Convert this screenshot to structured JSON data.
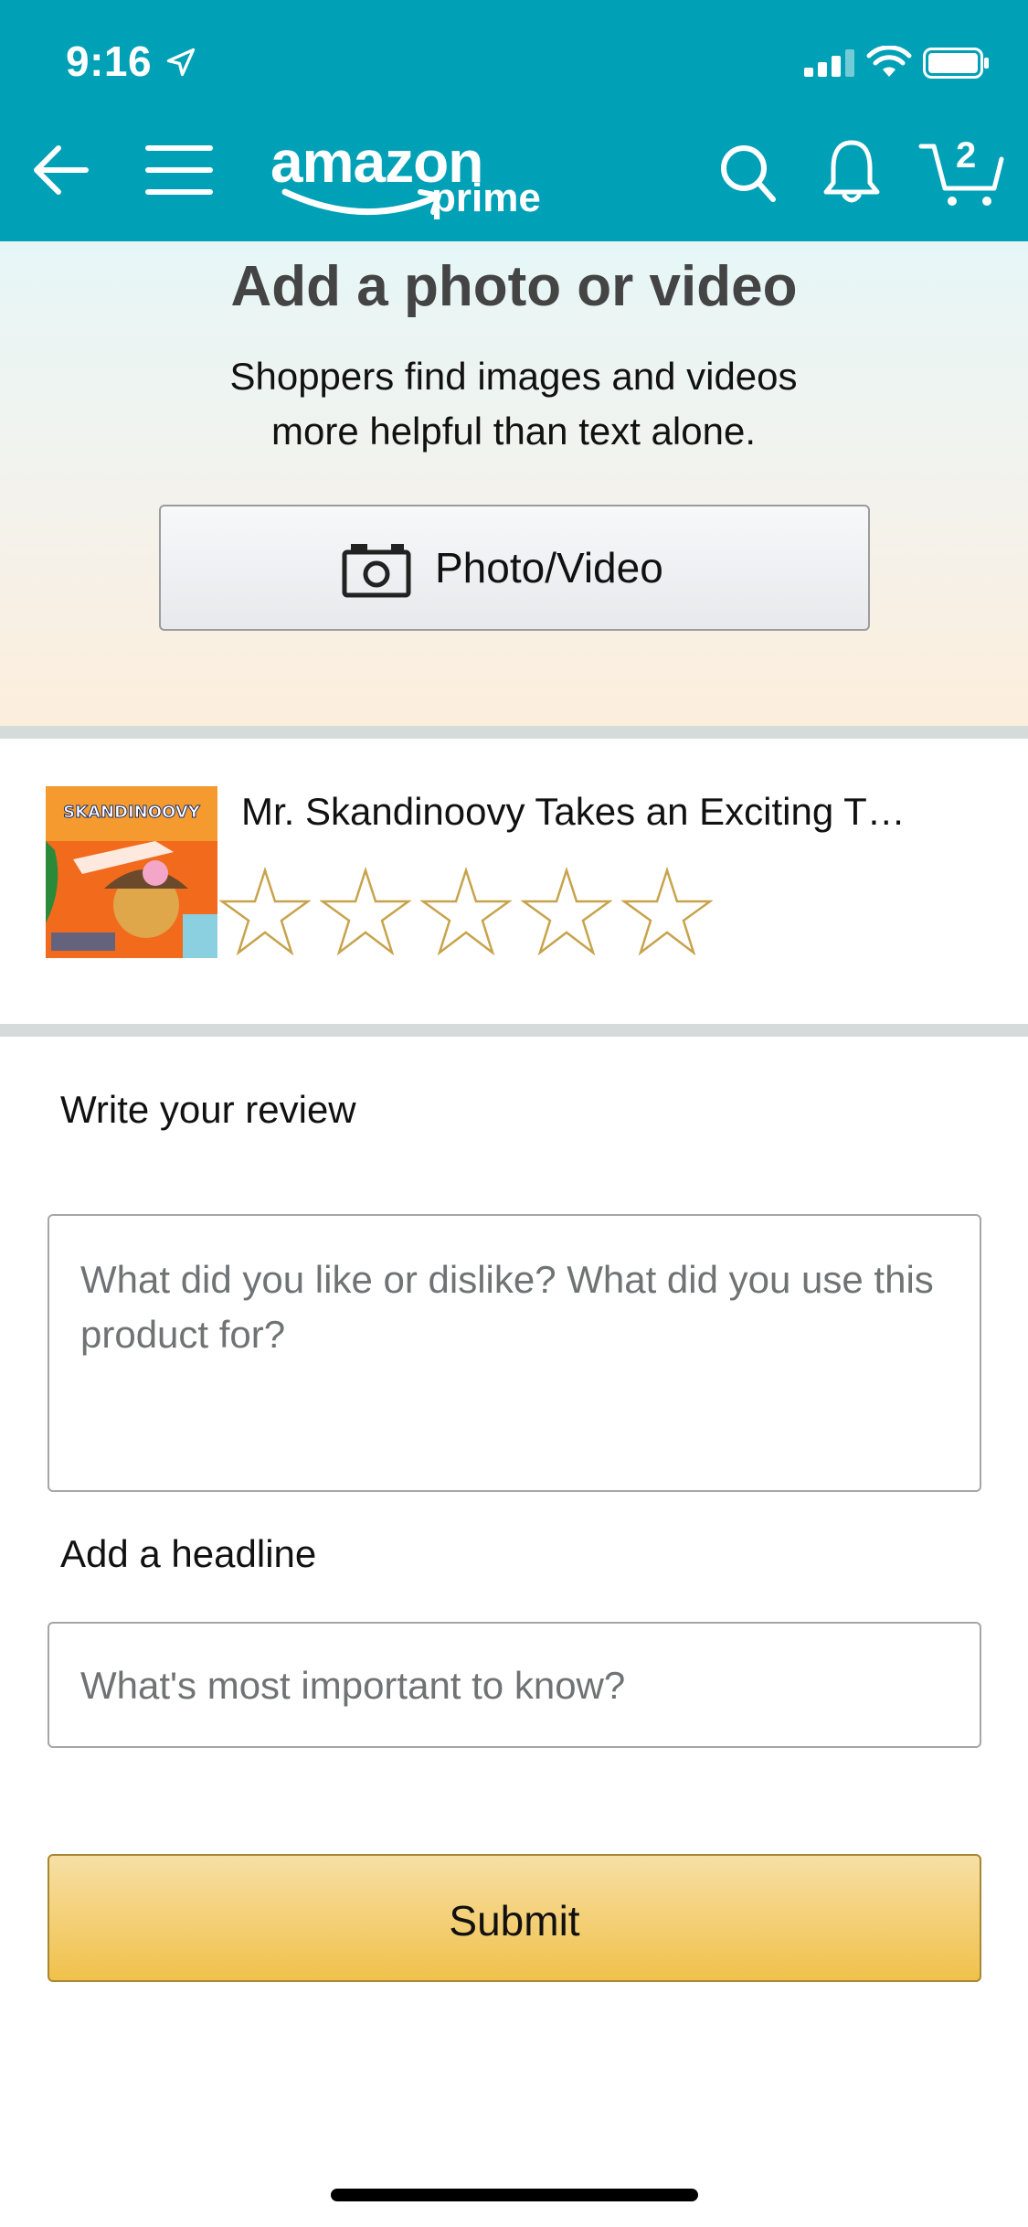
{
  "status_bar": {
    "time": "9:16"
  },
  "header": {
    "logo_text": "amazon",
    "logo_sub": "prime",
    "cart_count": "2",
    "icons": [
      "back-arrow-icon",
      "menu-icon",
      "search-icon",
      "bell-icon",
      "cart-icon"
    ],
    "color": "#00A0B6"
  },
  "photo_section": {
    "title": "Add a photo or video",
    "subtitle_line1": "Shoppers find images and videos",
    "subtitle_line2": "more helpful than text alone.",
    "button_label": "Photo/Video"
  },
  "product": {
    "title": "Mr. Skandinoovy Takes an Exciting T…",
    "image_text": "SKANDINOOVY",
    "rating": 0,
    "max_rating": 5
  },
  "review": {
    "label": "Write your review",
    "placeholder": "What did you like or dislike? What did you use this product for?"
  },
  "headline": {
    "label": "Add a headline",
    "placeholder": "What's most important to know?"
  },
  "submit": {
    "label": "Submit"
  },
  "colors": {
    "star_outline": "#C7A34B",
    "submit_bg": "#F0C14B",
    "divider": "#D5DBDB"
  }
}
